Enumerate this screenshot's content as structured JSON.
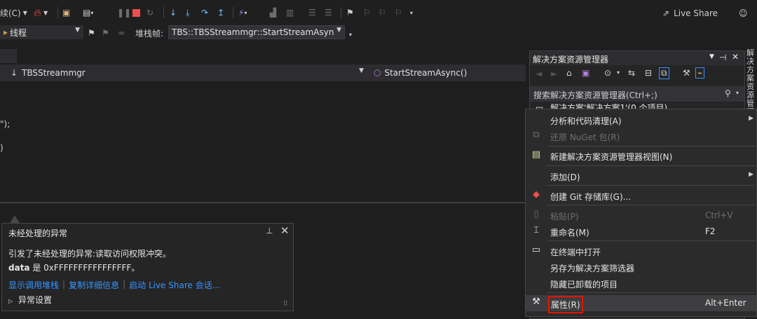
{
  "toolbar": {
    "continue_label": "续(C)",
    "live_share_label": "Live Share",
    "thread_label": "线程",
    "stack_frame_label": "堆栈帧:",
    "stack_frame_value": "TBS::TBSStreammgr::StartStreamAsyn"
  },
  "nav": {
    "class_combo": "TBSStreammgr",
    "method_combo": "StartStreamAsync()"
  },
  "editor": {
    "line1": "\");",
    "line2": ")"
  },
  "exception_popup": {
    "title": "未经处理的异常",
    "message": "引发了未经处理的异常:读取访问权限冲突。",
    "data_name": "data",
    "data_rest": "是 0xFFFFFFFFFFFFFFFF。",
    "link_call_stack": "显示调用堆栈",
    "link_copy_details": "复制详细信息",
    "link_live_share": "启动 Live Share 会话...",
    "exception_settings": "异常设置"
  },
  "solution_explorer": {
    "title": "解决方案资源管理器",
    "search_placeholder": "搜索解决方案资源管理器(Ctrl+;)",
    "solution_item": "解决方案'解决方案1'(0 个项目)",
    "vertical_tab": "解决方案资源管理器"
  },
  "context_menu": {
    "items": [
      {
        "label": "分析和代码清理(A)",
        "shortcut": "",
        "submenu": true,
        "disabled": false
      },
      {
        "label": "还原 NuGet 包(R)",
        "shortcut": "",
        "submenu": false,
        "disabled": true
      },
      {
        "label": "新建解决方案资源管理器视图(N)",
        "shortcut": "",
        "submenu": false,
        "disabled": false
      },
      {
        "label": "添加(D)",
        "shortcut": "",
        "submenu": true,
        "disabled": false
      },
      {
        "label": "创建 Git 存储库(G)...",
        "shortcut": "",
        "submenu": false,
        "disabled": false
      },
      {
        "label": "粘贴(P)",
        "shortcut": "Ctrl+V",
        "submenu": false,
        "disabled": true
      },
      {
        "label": "重命名(M)",
        "shortcut": "F2",
        "submenu": false,
        "disabled": false
      },
      {
        "label": "在终端中打开",
        "shortcut": "",
        "submenu": false,
        "disabled": false
      },
      {
        "label": "另存为解决方案筛选器",
        "shortcut": "",
        "submenu": false,
        "disabled": false
      },
      {
        "label": "隐藏已卸载的项目",
        "shortcut": "",
        "submenu": false,
        "disabled": false
      },
      {
        "label": "属性(R)",
        "shortcut": "Alt+Enter",
        "submenu": false,
        "disabled": false
      }
    ]
  },
  "colors": {
    "highlight_box": "#e51400",
    "link": "#3794ff",
    "accent_red": "#f14c4c"
  }
}
